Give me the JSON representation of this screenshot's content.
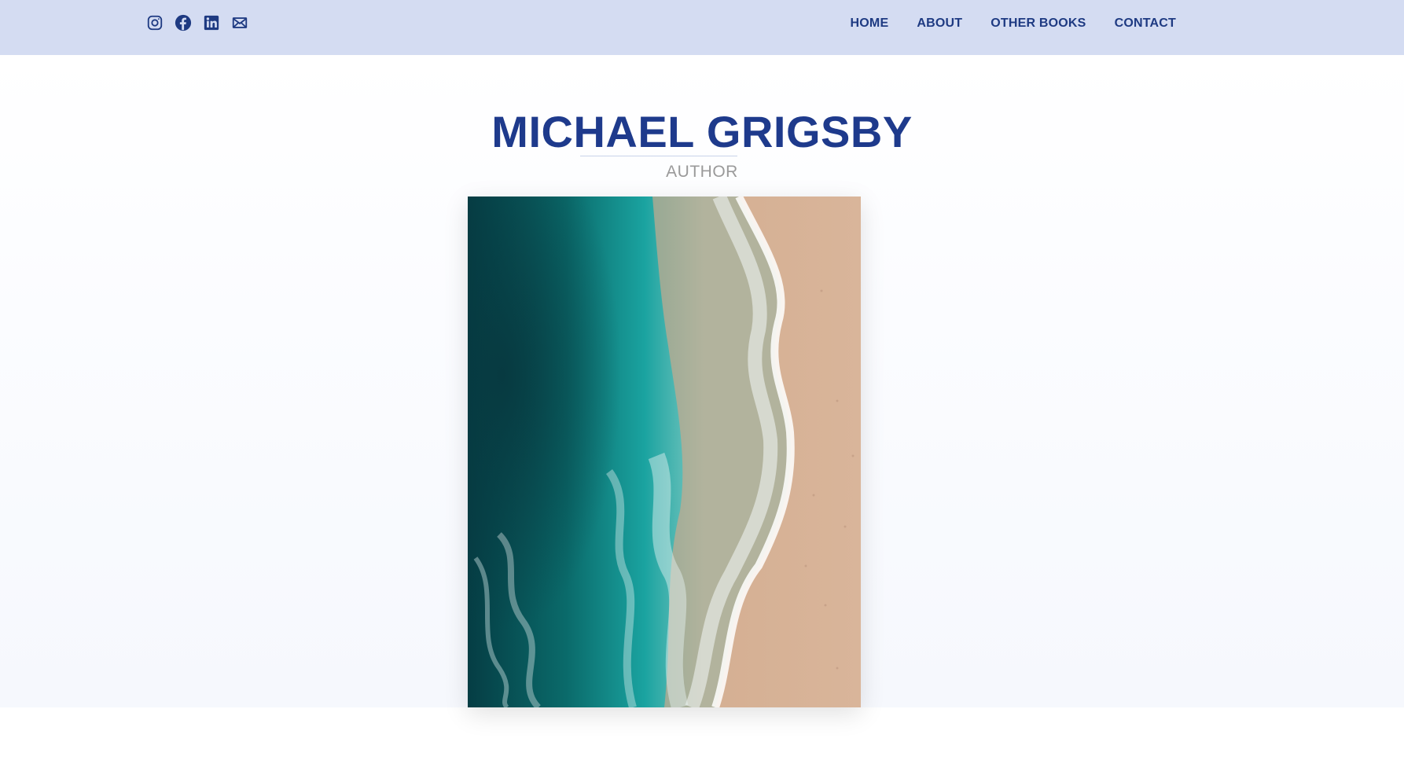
{
  "social": {
    "icons": [
      "instagram-icon",
      "facebook-icon",
      "linkedin-icon",
      "mail-icon"
    ]
  },
  "nav": {
    "items": [
      "HOME",
      "ABOUT",
      "OTHER BOOKS",
      "CONTACT"
    ]
  },
  "hero": {
    "name": "MICHAEL GRIGSBY",
    "role": "AUTHOR"
  },
  "colors": {
    "topbar": "#d4dcf2",
    "accent": "#1e3a8c",
    "muted": "#9a9a9a"
  }
}
